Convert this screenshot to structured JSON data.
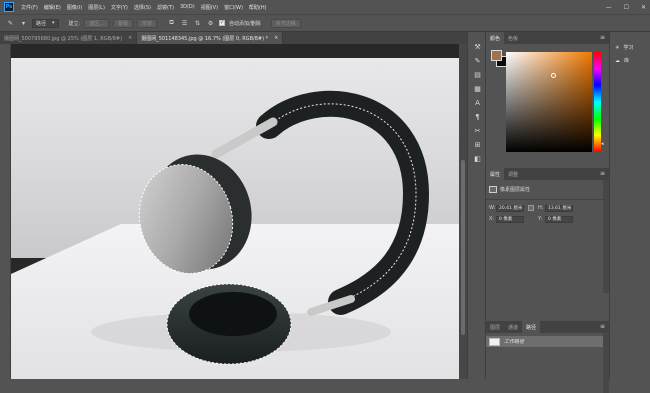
{
  "app": {
    "logo_text": "Ps"
  },
  "menu": [
    "文件(F)",
    "编辑(E)",
    "图像(I)",
    "图层(L)",
    "文字(Y)",
    "选择(S)",
    "滤镜(T)",
    "3D(D)",
    "视图(V)",
    "窗口(W)",
    "帮助(H)"
  ],
  "window_controls": {
    "minimize": "—",
    "maximize": "☐",
    "close": "✕"
  },
  "options": {
    "tool_glyph": "✎",
    "mode_select": "路径",
    "build_label": "建立:",
    "selection_btn": "选区...",
    "mask_btn": "蒙版",
    "shape_btn": "形状",
    "auto_add_delete_label": "自动添加/删除",
    "align_edges_label": "对齐边缘"
  },
  "doc_tabs": [
    {
      "label": "摄图网_500795680.jpg @ 25% (图层 1, RGB/8#)",
      "active": false,
      "close": "×"
    },
    {
      "label": "摄图网_501148345.jpg @ 16.7% (图层 0, RGB/8#) *",
      "active": true,
      "close": "×"
    }
  ],
  "collapsed_icons": [
    "⚒",
    "✎",
    "▤",
    "▦",
    "A",
    "¶",
    "✂",
    "⊞",
    "◧"
  ],
  "panels": {
    "color": {
      "tabs": [
        "颜色",
        "色板"
      ],
      "fg_color": "#a0724b",
      "bg_color": "#0a0a0a",
      "menu_icon": "≡"
    },
    "properties": {
      "tabs": [
        "属性",
        "调整"
      ],
      "menu_icon": "≡",
      "layer_type": "像素图层属性",
      "w_label": "W:",
      "w_value": "20.41 厘米",
      "h_label": "H:",
      "h_value": "13.61 厘米",
      "x_label": "X:",
      "x_value": "0 像素",
      "y_label": "Y:",
      "y_value": "0 像素"
    },
    "layers": {
      "tabs": [
        "图层",
        "通道",
        "路径"
      ],
      "active_tab": 2,
      "menu_icon": "≡",
      "path_item": "工作路径"
    }
  },
  "side_panel": [
    {
      "icon": "☀",
      "label": "学习"
    },
    {
      "icon": "☁",
      "label": "库"
    }
  ],
  "colors": {
    "ui_bg": "#535353",
    "canvas_bg": "#282828",
    "selection_accent": "#f07800"
  }
}
